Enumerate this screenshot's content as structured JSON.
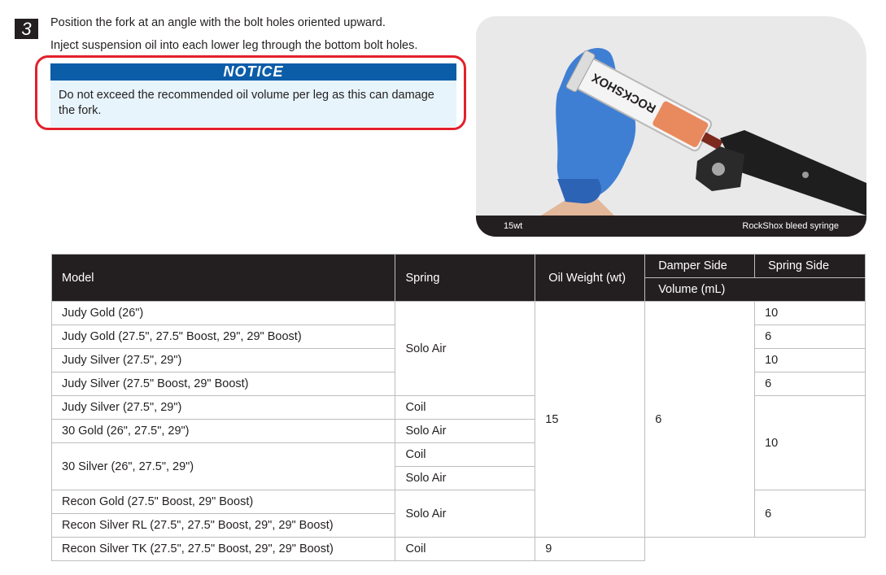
{
  "step": {
    "number": "3",
    "line1": "Position the fork at an angle with the bolt holes oriented upward.",
    "line2": "Inject suspension oil into each lower leg through the bottom bolt holes."
  },
  "notice": {
    "title": "NOTICE",
    "text": "Do not exceed the recommended oil volume per leg as this can damage the fork."
  },
  "photo": {
    "caption_left": "15wt",
    "caption_right": "RockShox bleed syringe",
    "syringe_text": "ROCKSHOX"
  },
  "table": {
    "headers": {
      "model": "Model",
      "spring": "Spring",
      "oil_weight": "Oil Weight (wt)",
      "damper_side": "Damper Side",
      "spring_side": "Spring Side",
      "volume": "Volume (mL)"
    },
    "models": [
      "Judy Gold (26\")",
      "Judy Gold (27.5\", 27.5\" Boost, 29\", 29\" Boost)",
      "Judy Silver (27.5\", 29\")",
      "Judy Silver (27.5\" Boost, 29\" Boost)",
      "Judy Silver (27.5\", 29\")",
      "30 Gold (26\", 27.5\", 29\")",
      "30 Silver (26\", 27.5\", 29\")",
      "Recon Gold (27.5\" Boost, 29\" Boost)",
      "Recon Silver RL (27.5\", 27.5\" Boost, 29\", 29\" Boost)",
      "Recon Silver TK (27.5\", 27.5\" Boost, 29\", 29\" Boost)"
    ],
    "springs": [
      "Solo Air",
      "Coil",
      "Solo Air",
      "Coil",
      "Solo Air",
      "Solo Air",
      "Coil"
    ],
    "oil_weight": "15",
    "damper_volume": "6",
    "spring_volumes": [
      "10",
      "6",
      "10",
      "6",
      "10",
      "6",
      "9"
    ]
  }
}
